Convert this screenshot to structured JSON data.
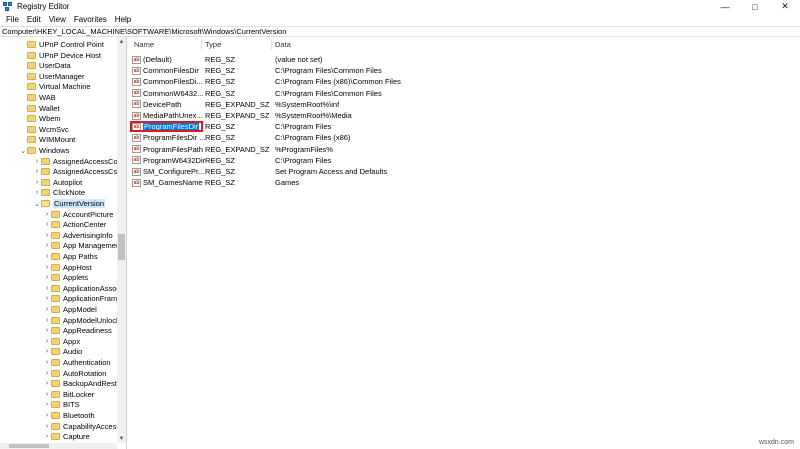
{
  "window": {
    "title": "Registry Editor",
    "controls": {
      "minimize": "—",
      "maximize": "□",
      "close": "✕"
    }
  },
  "menu": [
    "File",
    "Edit",
    "View",
    "Favorites",
    "Help"
  ],
  "address": "Computer\\HKEY_LOCAL_MACHINE\\SOFTWARE\\Microsoft\\Windows\\CurrentVersion",
  "tree": {
    "items": [
      {
        "label": "UPnP Control Point",
        "depth": 0,
        "expandable": false
      },
      {
        "label": "UPnP Device Host",
        "depth": 0,
        "expandable": false
      },
      {
        "label": "UserData",
        "depth": 0,
        "expandable": false
      },
      {
        "label": "UserManager",
        "depth": 0,
        "expandable": false
      },
      {
        "label": "Virtual Machine",
        "depth": 0,
        "expandable": false
      },
      {
        "label": "WAB",
        "depth": 0,
        "expandable": false
      },
      {
        "label": "Wallet",
        "depth": 0,
        "expandable": false
      },
      {
        "label": "Wbem",
        "depth": 0,
        "expandable": false
      },
      {
        "label": "WcmSvc",
        "depth": 0,
        "expandable": false
      },
      {
        "label": "WIMMount",
        "depth": 0,
        "expandable": false
      },
      {
        "label": "Windows",
        "depth": 0,
        "expandable": true,
        "expanded": true
      },
      {
        "label": "AssignedAccessConf",
        "depth": 1,
        "expandable": true
      },
      {
        "label": "AssignedAccessCsp",
        "depth": 1,
        "expandable": true
      },
      {
        "label": "Autopilot",
        "depth": 1,
        "expandable": true
      },
      {
        "label": "ClickNote",
        "depth": 1,
        "expandable": true
      },
      {
        "label": "CurrentVersion",
        "depth": 1,
        "expandable": true,
        "expanded": true,
        "selected": true
      },
      {
        "label": "AccountPicture",
        "depth": 2,
        "expandable": true
      },
      {
        "label": "ActionCenter",
        "depth": 2,
        "expandable": true
      },
      {
        "label": "AdvertisingInfo",
        "depth": 2,
        "expandable": true
      },
      {
        "label": "App Management",
        "depth": 2,
        "expandable": true
      },
      {
        "label": "App Paths",
        "depth": 2,
        "expandable": true
      },
      {
        "label": "AppHost",
        "depth": 2,
        "expandable": true
      },
      {
        "label": "Applets",
        "depth": 2,
        "expandable": true
      },
      {
        "label": "ApplicationAssoci",
        "depth": 2,
        "expandable": true
      },
      {
        "label": "ApplicationFrame",
        "depth": 2,
        "expandable": true
      },
      {
        "label": "AppModel",
        "depth": 2,
        "expandable": true
      },
      {
        "label": "AppModelUnlock",
        "depth": 2,
        "expandable": true
      },
      {
        "label": "AppReadiness",
        "depth": 2,
        "expandable": true
      },
      {
        "label": "Appx",
        "depth": 2,
        "expandable": true
      },
      {
        "label": "Audio",
        "depth": 2,
        "expandable": true
      },
      {
        "label": "Authentication",
        "depth": 2,
        "expandable": true
      },
      {
        "label": "AutoRotation",
        "depth": 2,
        "expandable": true
      },
      {
        "label": "BackupAndRestor",
        "depth": 2,
        "expandable": true
      },
      {
        "label": "BitLocker",
        "depth": 2,
        "expandable": true
      },
      {
        "label": "BITS",
        "depth": 2,
        "expandable": true
      },
      {
        "label": "Bluetooth",
        "depth": 2,
        "expandable": true
      },
      {
        "label": "CapabilityAccessM",
        "depth": 2,
        "expandable": true
      },
      {
        "label": "Capture",
        "depth": 2,
        "expandable": true
      }
    ]
  },
  "list": {
    "columns": {
      "name": "Name",
      "type": "Type",
      "data": "Data"
    },
    "rows": [
      {
        "name": "(Default)",
        "type": "REG_SZ",
        "data": "(value not set)",
        "icon": "ab"
      },
      {
        "name": "CommonFilesDir",
        "type": "REG_SZ",
        "data": "C:\\Program Files\\Common Files",
        "icon": "ab"
      },
      {
        "name": "CommonFilesDi...",
        "type": "REG_SZ",
        "data": "C:\\Program Files (x86)\\Common Files",
        "icon": "ab"
      },
      {
        "name": "CommonW6432...",
        "type": "REG_SZ",
        "data": "C:\\Program Files\\Common Files",
        "icon": "ab"
      },
      {
        "name": "DevicePath",
        "type": "REG_EXPAND_SZ",
        "data": "%SystemRoot%\\inf",
        "icon": "ab"
      },
      {
        "name": "MediaPathUnex...",
        "type": "REG_EXPAND_SZ",
        "data": "%SystemRoot%\\Media",
        "icon": "ab"
      },
      {
        "name": "ProgramFilesDir",
        "type": "REG_SZ",
        "data": "C:\\Program Files",
        "icon": "ab",
        "selected": true
      },
      {
        "name": "ProgramFilesDir ...",
        "type": "REG_SZ",
        "data": "C:\\Program Files (x86)",
        "icon": "ab"
      },
      {
        "name": "ProgramFilesPath",
        "type": "REG_EXPAND_SZ",
        "data": "%ProgramFiles%",
        "icon": "ab"
      },
      {
        "name": "ProgramW6432Dir",
        "type": "REG_SZ",
        "data": "C:\\Program Files",
        "icon": "ab"
      },
      {
        "name": "SM_ConfigurePr...",
        "type": "REG_SZ",
        "data": "Set Program Access and Defaults",
        "icon": "ab"
      },
      {
        "name": "SM_GamesName",
        "type": "REG_SZ",
        "data": "Games",
        "icon": "ab"
      }
    ]
  },
  "watermark": "wsxdn.com",
  "colors": {
    "selection": "#0078d7",
    "highlight_box": "#e01818",
    "folder": "#f3d27a"
  }
}
